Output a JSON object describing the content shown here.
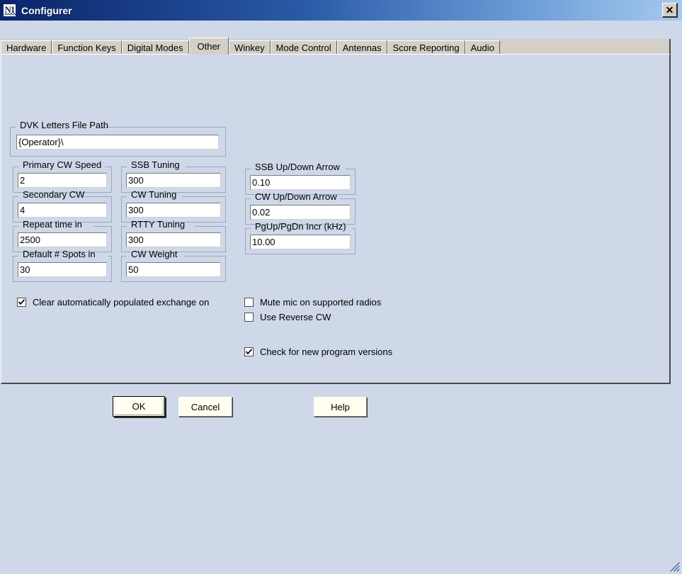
{
  "window": {
    "title": "Configurer",
    "icon": "n1-logo-icon",
    "close_label": "✕"
  },
  "tabs": [
    {
      "label": "Hardware",
      "selected": false
    },
    {
      "label": "Function Keys",
      "selected": false
    },
    {
      "label": "Digital Modes",
      "selected": false
    },
    {
      "label": "Other",
      "selected": true
    },
    {
      "label": "Winkey",
      "selected": false
    },
    {
      "label": "Mode Control",
      "selected": false
    },
    {
      "label": "Antennas",
      "selected": false
    },
    {
      "label": "Score Reporting",
      "selected": false
    },
    {
      "label": "Audio",
      "selected": false
    }
  ],
  "other_tab": {
    "dvk": {
      "label": "DVK Letters File Path",
      "value": "{Operator}\\"
    },
    "column_left": [
      {
        "label": "Primary CW Speed",
        "value": "2"
      },
      {
        "label": "Secondary CW",
        "value": "4"
      },
      {
        "label": "Repeat time in",
        "value": "2500"
      },
      {
        "label": "Default # Spots in",
        "value": "30"
      }
    ],
    "column_middle": [
      {
        "label": "SSB Tuning",
        "value": "300"
      },
      {
        "label": "CW Tuning",
        "value": "300"
      },
      {
        "label": "RTTY Tuning",
        "value": "300"
      },
      {
        "label": "CW Weight",
        "value": "50"
      }
    ],
    "column_right": [
      {
        "label": "SSB Up/Down Arrow",
        "value": "0.10"
      },
      {
        "label": "CW Up/Down Arrow",
        "value": "0.02"
      },
      {
        "label": "PgUp/PgDn Incr (kHz)",
        "value": "10.00"
      }
    ],
    "checkboxes": [
      {
        "label": "Clear automatically populated exchange on",
        "checked": true
      },
      {
        "label": "Mute mic on supported radios",
        "checked": false
      },
      {
        "label": "Use Reverse CW",
        "checked": false
      },
      {
        "label": "Check for new program versions",
        "checked": true
      }
    ]
  },
  "buttons": {
    "ok": "OK",
    "cancel": "Cancel",
    "help": "Help"
  },
  "colors": {
    "dialog_background": "#ced8e8",
    "tab_strip": "#d4d0c8",
    "titlebar_start": "#0a246a",
    "titlebar_end": "#a6caf0",
    "button_face": "#fffef0",
    "field_background": "#ffffff"
  }
}
